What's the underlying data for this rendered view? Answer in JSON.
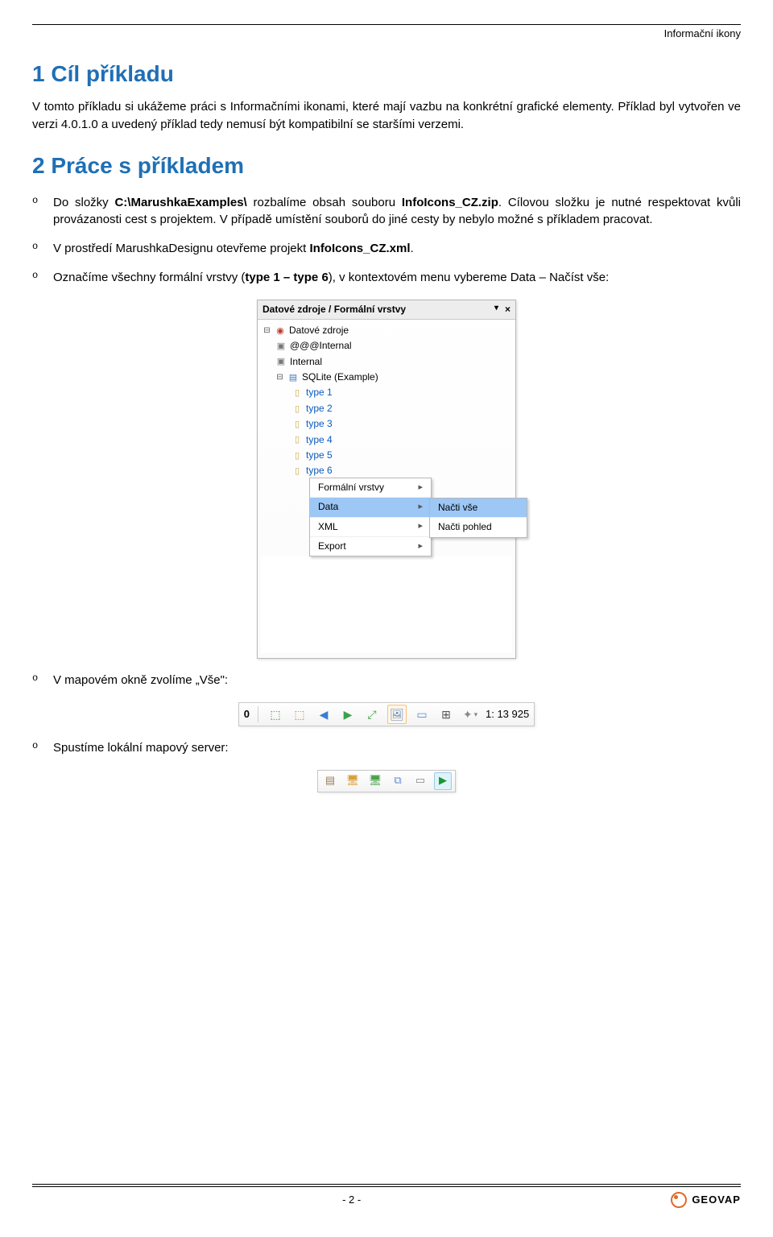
{
  "header": {
    "right_label": "Informační ikony"
  },
  "section1": {
    "heading": "1  Cíl příkladu",
    "paragraph": "V tomto příkladu si ukážeme práci s Informačními ikonami, které mají vazbu na konkrétní grafické elementy. Příklad byl vytvořen ve verzi 4.0.1.0 a uvedený příklad tedy nemusí být kompatibilní se staršími verzemi."
  },
  "section2": {
    "heading": "2  Práce s příkladem",
    "items": [
      {
        "html": "Do složky <b>C:\\MarushkaExamples\\</b> rozbalíme obsah souboru <b>InfoIcons_CZ.zip</b>. Cílovou složku je nutné respektovat kvůli provázanosti cest s projektem. V případě umístění souborů do jiné cesty by nebylo možné s příkladem pracovat."
      },
      {
        "html": "V prostředí MarushkaDesignu otevřeme projekt <b>InfoIcons_CZ.xml</b>."
      },
      {
        "html": "Označíme všechny formální vrstvy (<b>type 1 – type 6</b>), v kontextovém menu vybereme Data – Načíst vše:"
      },
      {
        "html": "V mapovém okně zvolíme „Vše\":"
      },
      {
        "html": "Spustíme lokální mapový server:"
      }
    ]
  },
  "panel1": {
    "title": "Datové zdroje / Formální vrstvy",
    "root": "Datové zdroje",
    "internal1": "@@@Internal",
    "internal2": "Internal",
    "sqlite": "SQLite (Example)",
    "types": [
      "type 1",
      "type 2",
      "type 3",
      "type 4",
      "type 5",
      "type 6"
    ],
    "menu": [
      "Formální vrstvy",
      "Data",
      "XML",
      "Export"
    ],
    "submenu": [
      "Načti vše",
      "Načti pohled"
    ]
  },
  "panel2": {
    "left_num": "0",
    "scale": "1: 13 925"
  },
  "footer": {
    "page": "- 2 -",
    "brand": "GEOVAP"
  }
}
